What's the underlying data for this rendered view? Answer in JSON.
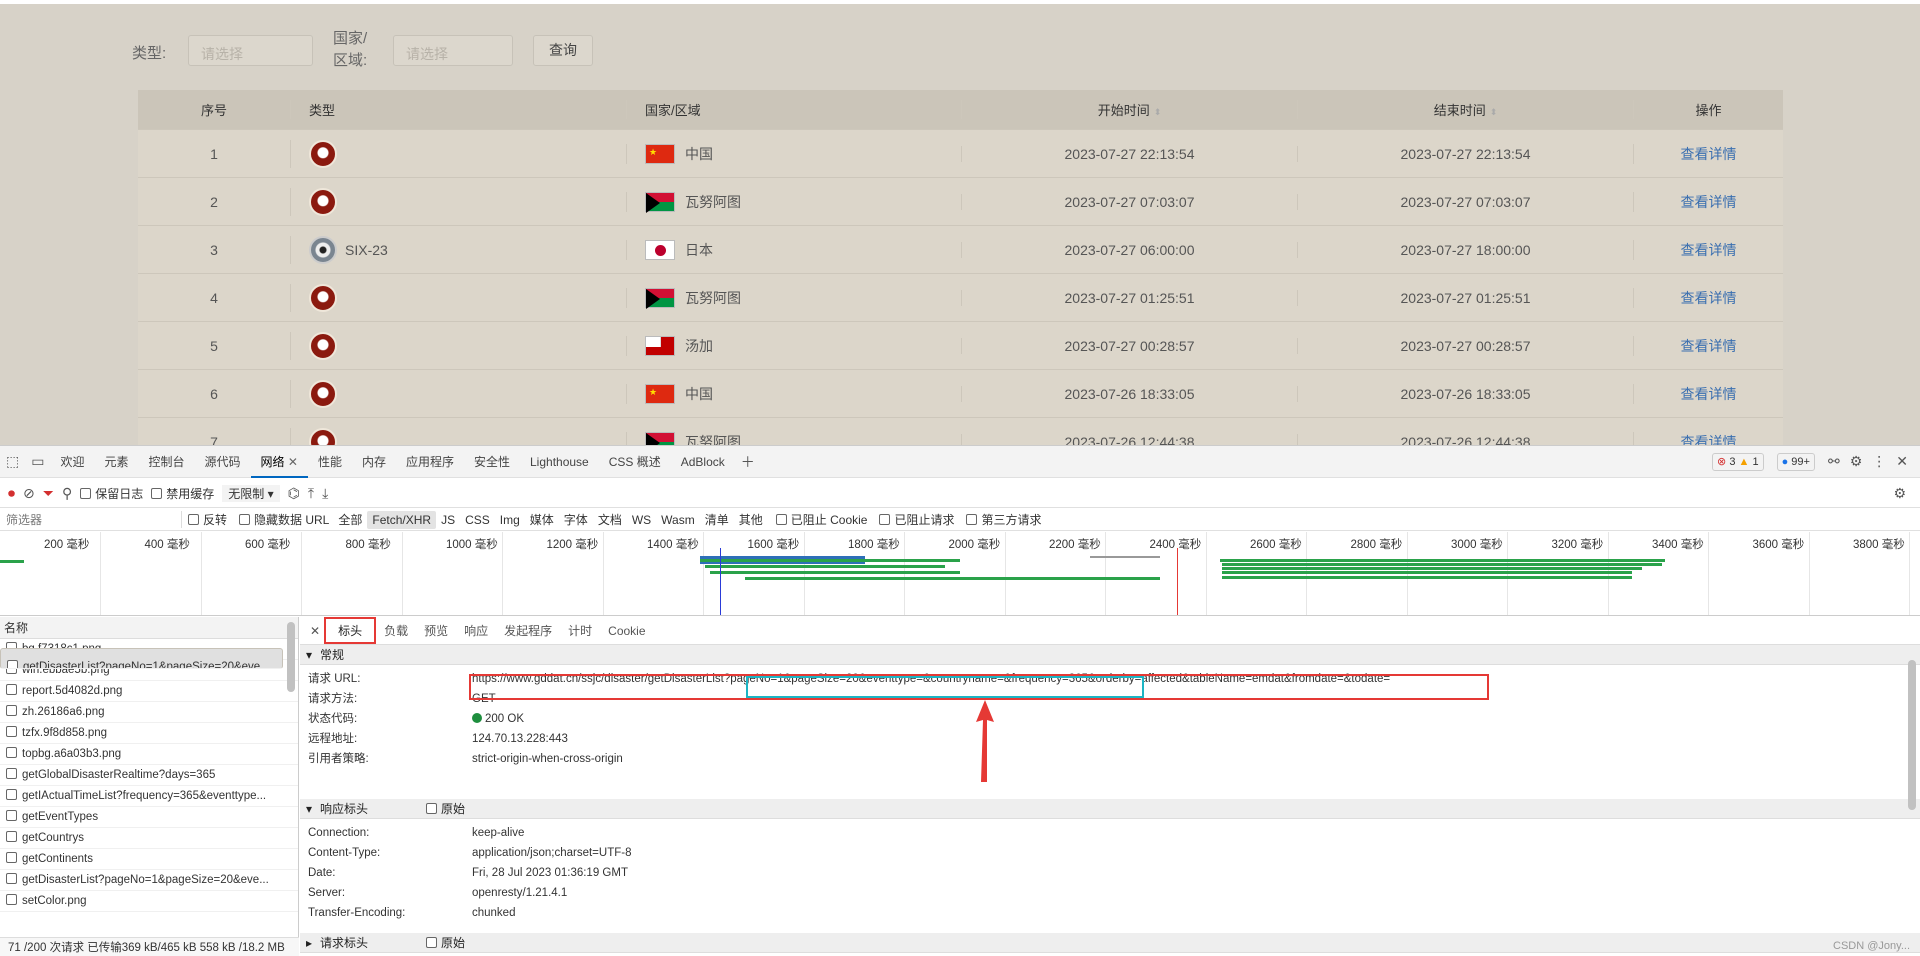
{
  "app": {
    "type_label": "类型:",
    "type_placeholder": "请选择",
    "country_label_1": "国家/",
    "country_label_2": "区域:",
    "country_placeholder": "请选择",
    "query_button": "查询",
    "table_headers": {
      "index": "序号",
      "type": "类型",
      "country": "国家/区域",
      "start": "开始时间",
      "end": "结束时间",
      "ops": "操作"
    },
    "rows": [
      {
        "index": "1",
        "type_icon": "disaster-icon",
        "type_text": "",
        "flag": "cn",
        "country": "中国",
        "start": "2023-07-27 22:13:54",
        "end": "2023-07-27 22:13:54",
        "action": "查看详情"
      },
      {
        "index": "2",
        "type_icon": "disaster-icon",
        "type_text": "",
        "flag": "vu",
        "country": "瓦努阿图",
        "start": "2023-07-27 07:03:07",
        "end": "2023-07-27 07:03:07",
        "action": "查看详情"
      },
      {
        "index": "3",
        "type_icon": "typhoon-icon",
        "type_text": "SIX-23",
        "flag": "jp",
        "country": "日本",
        "start": "2023-07-27 06:00:00",
        "end": "2023-07-27 18:00:00",
        "action": "查看详情"
      },
      {
        "index": "4",
        "type_icon": "disaster-icon",
        "type_text": "",
        "flag": "vu",
        "country": "瓦努阿图",
        "start": "2023-07-27 01:25:51",
        "end": "2023-07-27 01:25:51",
        "action": "查看详情"
      },
      {
        "index": "5",
        "type_icon": "disaster-icon",
        "type_text": "",
        "flag": "to",
        "country": "汤加",
        "start": "2023-07-27 00:28:57",
        "end": "2023-07-27 00:28:57",
        "action": "查看详情"
      },
      {
        "index": "6",
        "type_icon": "disaster-icon",
        "type_text": "",
        "flag": "cn",
        "country": "中国",
        "start": "2023-07-26 18:33:05",
        "end": "2023-07-26 18:33:05",
        "action": "查看详情"
      },
      {
        "index": "7",
        "type_icon": "disaster-icon",
        "type_text": "",
        "flag": "vu",
        "country": "瓦努阿图",
        "start": "2023-07-26 12:44:38",
        "end": "2023-07-26 12:44:38",
        "action": "查看详情"
      }
    ]
  },
  "devtools": {
    "tabs": [
      "欢迎",
      "元素",
      "控制台",
      "源代码",
      "网络",
      "性能",
      "内存",
      "应用程序",
      "安全性",
      "Lighthouse",
      "CSS 概述",
      "AdBlock"
    ],
    "active_tab": "网络",
    "errors": "3",
    "warnings": "1",
    "messages": "99+",
    "toolbar": {
      "preserve_log": "保留日志",
      "disable_cache": "禁用缓存",
      "throttle": "无限制"
    },
    "filter_placeholder": "筛选器",
    "filter_opts": {
      "invert": "反转",
      "hide_data": "隐藏数据 URL",
      "all": "全部",
      "blocked_cookie": "已阻止 Cookie",
      "blocked_req": "已阻止请求",
      "third_party": "第三方请求"
    },
    "type_filters": [
      "Fetch/XHR",
      "JS",
      "CSS",
      "Img",
      "媒体",
      "字体",
      "文档",
      "WS",
      "Wasm",
      "清单",
      "其他"
    ],
    "timeline_ticks": [
      "200 毫秒",
      "400 毫秒",
      "600 毫秒",
      "800 毫秒",
      "1000 毫秒",
      "1200 毫秒",
      "1400 毫秒",
      "1600 毫秒",
      "1800 毫秒",
      "2000 毫秒",
      "2200 毫秒",
      "2400 毫秒",
      "2600 毫秒",
      "2800 毫秒",
      "3000 毫秒",
      "3200 毫秒",
      "3400 毫秒",
      "3600 毫秒",
      "3800 毫秒"
    ],
    "name_header": "名称",
    "requests": [
      "bg.f7318c1.png",
      "win.ebbae5b.png",
      "report.5d4082d.png",
      "zh.26186a6.png",
      "tzfx.9f8d858.png",
      "topbg.a6a03b3.png",
      "getGlobalDisasterRealtime?days=365",
      "getIActualTimeList?frequency=365&eventtype...",
      "getEventTypes",
      "getCountrys",
      "getContinents",
      "getDisasterList?pageNo=1&pageSize=20&eve...",
      "getDisasterList?pageNo=1&pageSize=20&eve...",
      "setColor.png"
    ],
    "status_bar": "71 /200 次请求  已传输369 kB/465 kB  558 kB /18.2 MB",
    "detail_tabs": [
      "标头",
      "负载",
      "预览",
      "响应",
      "发起程序",
      "计时",
      "Cookie"
    ],
    "general_title": "常规",
    "general": [
      {
        "k": "请求 URL:",
        "v": "https://www.gddat.cn/ssjc/disaster/getDisasterList?pageNo=1&pageSize=20&eventtype=&countryname=&frequency=365&orderby=affected&tableName=emdat&fromdate=&todate="
      },
      {
        "k": "请求方法:",
        "v": "GET"
      },
      {
        "k": "状态代码:",
        "v": "200 OK"
      },
      {
        "k": "远程地址:",
        "v": "124.70.13.228:443"
      },
      {
        "k": "引用者策略:",
        "v": "strict-origin-when-cross-origin"
      }
    ],
    "response_title": "响应标头",
    "raw_label": "原始",
    "response": [
      {
        "k": "Connection:",
        "v": "keep-alive"
      },
      {
        "k": "Content-Type:",
        "v": "application/json;charset=UTF-8"
      },
      {
        "k": "Date:",
        "v": "Fri, 28 Jul 2023 01:36:19 GMT"
      },
      {
        "k": "Server:",
        "v": "openresty/1.21.4.1"
      },
      {
        "k": "Transfer-Encoding:",
        "v": "chunked"
      }
    ],
    "request_title": "请求标头",
    "watermark": "CSDN @Jony..."
  }
}
